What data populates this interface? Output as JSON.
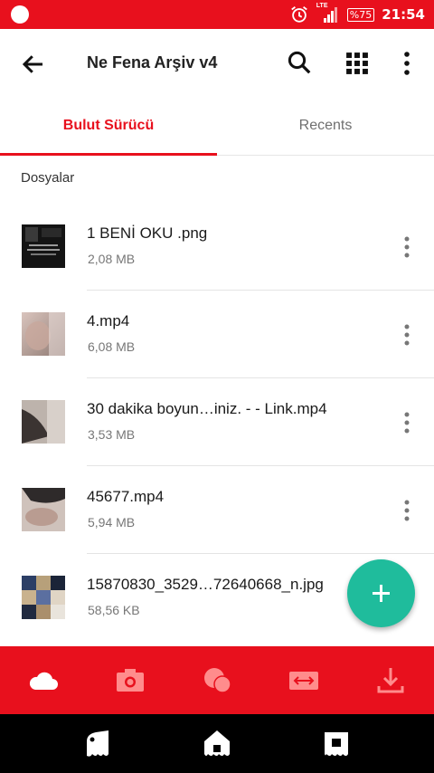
{
  "status_bar": {
    "network": "LTE",
    "battery": "%75",
    "time": "21:54"
  },
  "app_bar": {
    "title": "Ne Fena Arşiv v4",
    "icons": [
      "back-arrow-icon",
      "search-icon",
      "grid-view-icon",
      "more-vert-icon"
    ]
  },
  "tabs": [
    {
      "label": "Bulut Sürücü",
      "active": true
    },
    {
      "label": "Recents",
      "active": false
    }
  ],
  "section_header": "Dosyalar",
  "files": [
    {
      "name": "1 BENİ OKU .png",
      "size": "2,08 MB"
    },
    {
      "name": "4.mp4",
      "size": "6,08 MB"
    },
    {
      "name": "30 dakika boyun…iniz. - - Link.mp4",
      "size": "3,53 MB"
    },
    {
      "name": "45677.mp4",
      "size": "5,94 MB"
    },
    {
      "name": "15870830_3529…72640668_n.jpg",
      "size": "58,56 KB"
    }
  ],
  "bottom_nav": [
    "cloud-icon",
    "camera-icon",
    "chat-icon",
    "transfer-icon",
    "download-icon"
  ],
  "colors": {
    "primary": "#e8101d",
    "fab": "#1fbc9c",
    "active_tab": "#e8101d",
    "inactive_icon": "#ff8c8c"
  }
}
